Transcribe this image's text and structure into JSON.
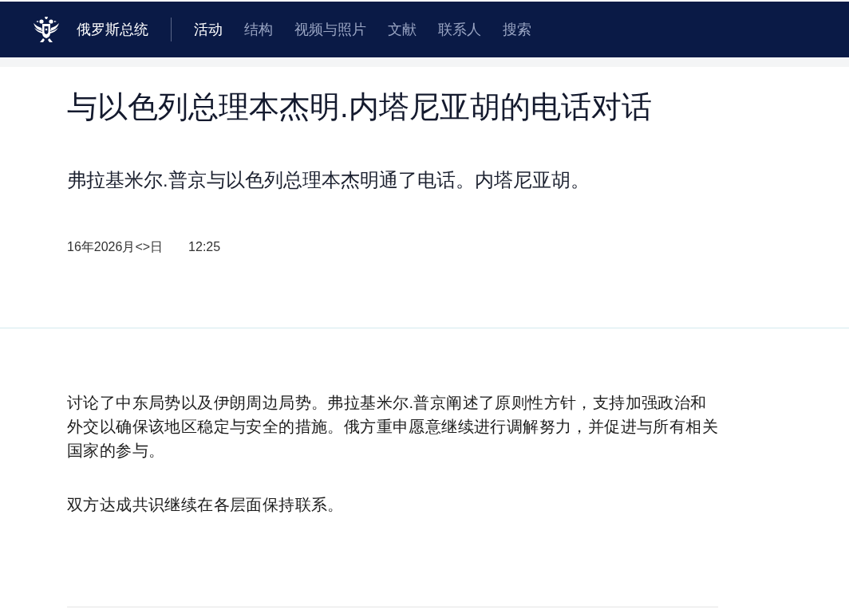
{
  "header": {
    "site_title": "俄罗斯总统",
    "nav": [
      {
        "label": "活动",
        "selected": true
      },
      {
        "label": "结构",
        "selected": false
      },
      {
        "label": "视频与照片",
        "selected": false
      },
      {
        "label": "文献",
        "selected": false
      },
      {
        "label": "联系人",
        "selected": false
      },
      {
        "label": "搜索",
        "selected": false
      }
    ]
  },
  "article": {
    "title": "与以色列总理本杰明.内塔尼亚胡的电话对话",
    "lead": "弗拉基米尔.普京与以色列总理本杰明通了电话。内塔尼亚胡。",
    "date": "16年2026月<>日",
    "time": "12:25",
    "paragraphs": [
      "讨论了中东局势以及伊朗周边局势。弗拉基米尔.普京阐述了原则性方针，支持加强政治和外交以确保该地区稳定与安全的措施。俄方重申愿意继续进行调解努力，并促进与所有相关国家的参与。",
      "双方达成共识继续在各层面保持联系。"
    ]
  }
}
